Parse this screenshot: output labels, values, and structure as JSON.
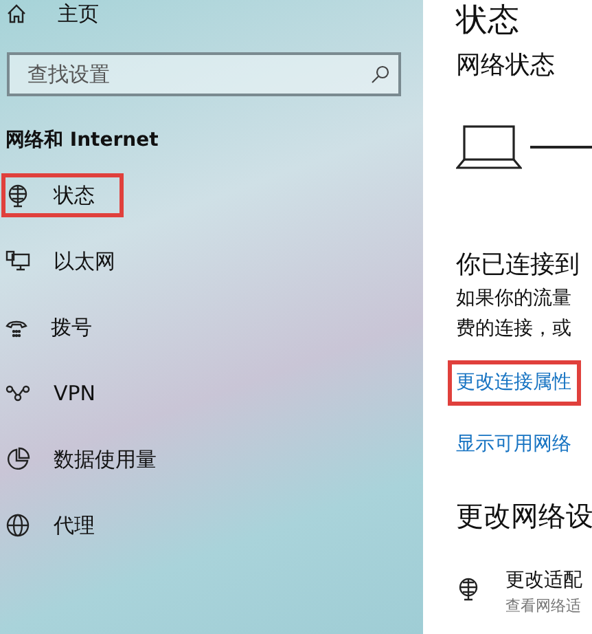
{
  "sidebar": {
    "home": {
      "label": "主页"
    },
    "search": {
      "placeholder": "查找设置"
    },
    "section_title": "网络和 Internet",
    "items": [
      {
        "kind": "status",
        "label": "状态",
        "highlighted": true
      },
      {
        "kind": "ethernet",
        "label": "以太网",
        "highlighted": false
      },
      {
        "kind": "dialup",
        "label": "拨号",
        "highlighted": false
      },
      {
        "kind": "vpn",
        "label": "VPN",
        "highlighted": false
      },
      {
        "kind": "data",
        "label": "数据使用量",
        "highlighted": false
      },
      {
        "kind": "proxy",
        "label": "代理",
        "highlighted": false
      }
    ]
  },
  "content": {
    "title": "状态",
    "network_status": "网络状态",
    "connected_heading": "你已连接到",
    "description": [
      "如果你的流量",
      "费的连接，或"
    ],
    "links": [
      {
        "label": "更改连接属性",
        "highlighted": true
      },
      {
        "label": "显示可用网络",
        "highlighted": false
      }
    ],
    "settings_heading": "更改网络设",
    "settings_items": [
      {
        "title": "更改适配",
        "subtitle": "查看网络适"
      }
    ]
  }
}
